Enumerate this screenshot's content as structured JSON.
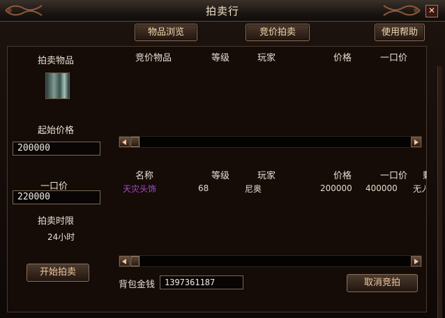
{
  "window": {
    "title": "拍卖行",
    "close_glyph": "✕"
  },
  "tabs": {
    "browse": "物品浏览",
    "bid": "竞价拍卖",
    "help": "使用帮助"
  },
  "sell": {
    "item_label": "拍卖物品",
    "item_icon": "cloth-armor-icon",
    "start_price_label": "起始价格",
    "start_price": "200000",
    "buyout_label": "一口价",
    "buyout": "220000",
    "duration_label": "拍卖时限",
    "duration": "24小时",
    "start_button": "开始拍卖"
  },
  "bids": {
    "headers": {
      "item": "竞价物品",
      "level": "等级",
      "player": "玩家",
      "price": "价格",
      "buyout": "一口价"
    },
    "rows": []
  },
  "listings": {
    "headers": {
      "name": "名称",
      "level": "等级",
      "player": "玩家",
      "price": "价格",
      "buyout": "一口价",
      "extra": "剩"
    },
    "rows": [
      {
        "name": "天灾头饰",
        "level": "68",
        "player": "尼奥",
        "price": "200000",
        "buyout": "400000",
        "extra": "无人"
      }
    ]
  },
  "footer": {
    "gold_label": "背包金钱",
    "gold": "1397361187",
    "cancel_button": "取消竞拍"
  },
  "colors": {
    "item_name_purple": "#a050c8",
    "button_text": "#f3c9a0",
    "accent_brown": "#8a7058"
  }
}
